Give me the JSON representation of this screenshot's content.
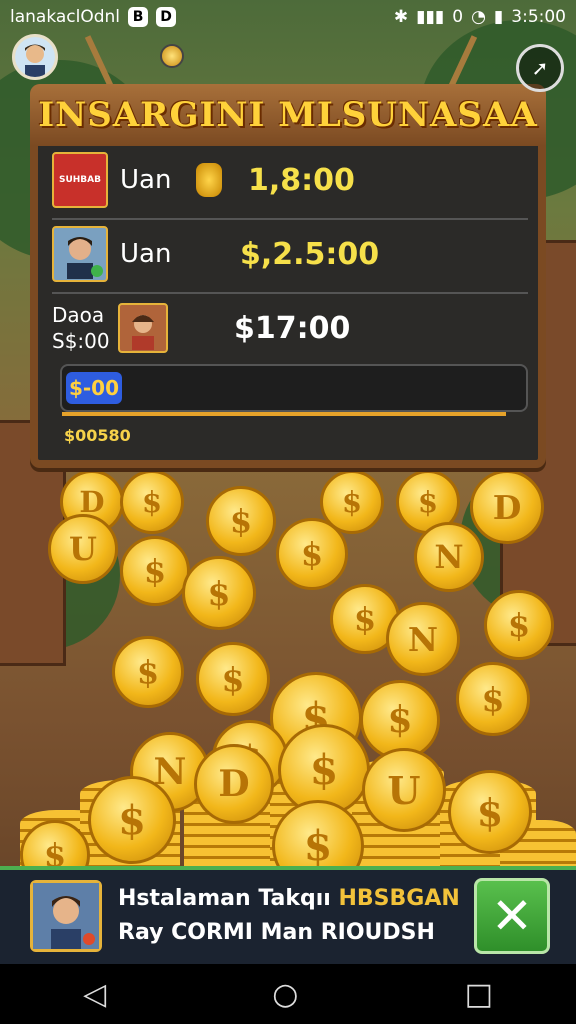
{
  "status_bar": {
    "left_text": "lanakaclOdnl",
    "left_icon_1": "B",
    "left_icon_2": "D",
    "right_text": "0",
    "clock": "3:5:00"
  },
  "panel": {
    "title": "INSARGINI MLSUNASAA",
    "rows": [
      {
        "thumb_label": "SUHBAB",
        "name": "Uan",
        "amount": "1,8:00"
      },
      {
        "name": "Uan",
        "amount": "$,2.5:00"
      },
      {
        "name_line1": "Daoa",
        "name_line2": "S$:00",
        "amount": "$17:00"
      }
    ],
    "bar_label": "$-00",
    "footer": "$00580"
  },
  "coins": {
    "symbols": [
      "D",
      "$",
      "$",
      "$",
      "D",
      "$",
      "U",
      "$",
      "$",
      "$",
      "N",
      "$",
      "N",
      "$",
      "$",
      "$",
      "$",
      "$",
      "$",
      "N",
      "$"
    ]
  },
  "ad": {
    "line1_prefix": "Hstalaman Takqıı ",
    "line1_highlight": "HBSBGAN",
    "line2": "Ray CORMI Man RIOUDSH",
    "close_label": "✕"
  },
  "navbar": {
    "back": "◁",
    "home": "○",
    "recents": "□"
  }
}
